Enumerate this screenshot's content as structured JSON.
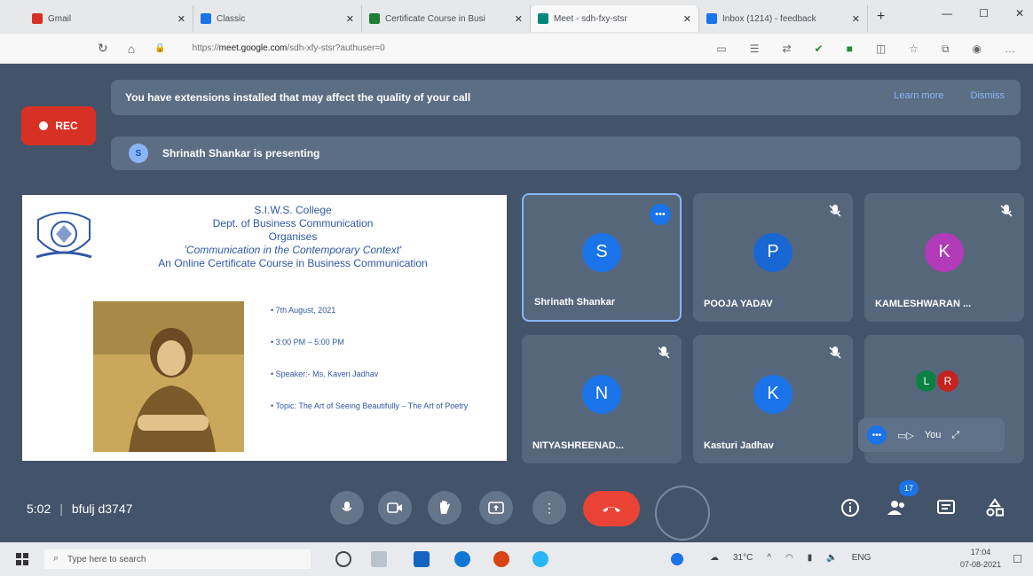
{
  "browser": {
    "tabs": [
      {
        "title": "Gmail",
        "color": "#d93025"
      },
      {
        "title": "Classic",
        "color": "#1a73e8"
      },
      {
        "title": "Certificate Course in Busi",
        "color": "#1e7e34"
      },
      {
        "title": "Meet - sdh-fxy-stsr",
        "color": "#00897b"
      },
      {
        "title": "Inbox (1214) - feedback",
        "color": "#1a73e8"
      }
    ],
    "url_prefix": "https://",
    "url_host": "meet.google.com",
    "url_path": "/sdh-xfy-stsr?authuser=0"
  },
  "meet": {
    "banner_text": "You have extensions installed that may affect the quality of your call",
    "banner_learn": "Learn more",
    "banner_dismiss": "Dismiss",
    "rec_label": "REC",
    "presenting_initial": "S",
    "presenting_text": "Shrinath Shankar is presenting",
    "slide": {
      "line1": "S.I.W.S. College",
      "line2": "Dept. of Business Communication",
      "line3": "Organises",
      "line4": "'Communication in the Contemporary Context'",
      "line5": "An Online Certificate Course in Business Communication",
      "bullets": [
        "• 7th August, 2021",
        "• 3:00 PM – 5:00 PM",
        "• Speaker:- Ms. Kaveri Jadhav",
        "• Topic: The Art of Seeing Beautifully – The Art of Poetry"
      ]
    },
    "participants": [
      {
        "initial": "S",
        "name": "Shrinath Shankar",
        "color": "#1a73e8"
      },
      {
        "initial": "P",
        "name": "POOJA YADAV",
        "color": "#1967d2"
      },
      {
        "initial": "K",
        "name": "KAMLESHWARAN ...",
        "color": "#b23ab8"
      },
      {
        "initial": "N",
        "name": "NITYASHREENAD...",
        "color": "#1a73e8"
      },
      {
        "initial": "K",
        "name": "Kasturi Jadhav",
        "color": "#1a73e8"
      }
    ],
    "others": [
      {
        "initial": "L",
        "color": "#0b8043"
      },
      {
        "initial": "R",
        "color": "#c5221f"
      }
    ],
    "self_label": "You",
    "time": "5:02",
    "meeting_code": "bfulj d3747",
    "participant_count": "17"
  },
  "taskbar": {
    "search_placeholder": "Type here to search",
    "weather": "31°C",
    "lang": "ENG",
    "time": "17:04",
    "date": "07-08-2021"
  }
}
